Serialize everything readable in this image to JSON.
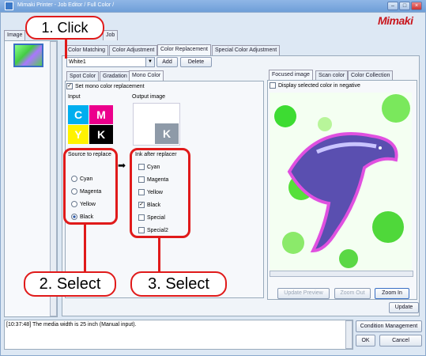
{
  "window": {
    "title": "Mimaki Printer - Job Editor / Full Color /",
    "logo": "Mimaki"
  },
  "left_tabs": [
    "Image",
    "Job"
  ],
  "main_tabs": [
    "Color Matching",
    "Color Adjustment",
    "Color Replacement",
    "Special Color Adjustment"
  ],
  "replacement": {
    "combo_value": "White1",
    "add": "Add",
    "delete": "Delete"
  },
  "sub_tabs": [
    "Spot Color",
    "Gradation",
    "Mono Color"
  ],
  "mono": {
    "set_label": "Set mono color replacement",
    "input_label": "Input",
    "output_label": "Output image",
    "cmyk": [
      "C",
      "M",
      "Y",
      "K"
    ],
    "output_letter": "K",
    "source_title": "Source to replace",
    "source_options": [
      "Cyan",
      "Magenta",
      "Yellow",
      "Black"
    ],
    "ink_title": "Ink after replacer",
    "ink_options": [
      "Cyan",
      "Magenta",
      "Yellow",
      "Black",
      "Special",
      "Special2"
    ]
  },
  "right_tabs": [
    "Focused image",
    "Scan color",
    "Color Collection"
  ],
  "display_negative": "Display selected color in negative",
  "preview_buttons": {
    "update_preview": "Update Preview",
    "zoom_out": "Zoom Out",
    "zoom_in": "Zoom In"
  },
  "update": "Update",
  "log": "[10:37:48] The media width is 25 inch (Manual input).",
  "bottom_buttons": {
    "condition": "Condition Management",
    "ok": "OK",
    "cancel": "Cancel"
  },
  "callouts": {
    "step1": "1. Click",
    "step2": "2. Select",
    "step3": "3. Select"
  },
  "colors": {
    "accent": "#e01a1a",
    "cyan": "#00aeef",
    "magenta": "#ec008c",
    "yellow": "#fff200",
    "black": "#000000"
  }
}
